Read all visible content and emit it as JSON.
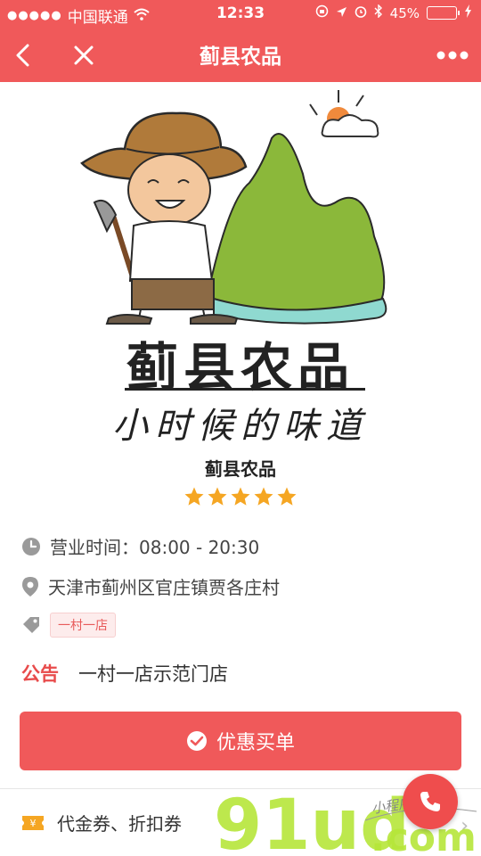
{
  "status_bar": {
    "carrier": "中国联通",
    "time": "12:33",
    "battery_percent": "45%",
    "battery_level": 0.45,
    "signal_dots": "●●●●●"
  },
  "nav": {
    "title": "蓟县农品",
    "back_icon": "chevron-left-icon",
    "close_icon": "close-icon",
    "more_icon": "more-dots-icon"
  },
  "logo": {
    "title": "蓟县农品",
    "slogan": "小时候的味道"
  },
  "shop": {
    "name": "蓟县农品",
    "rating": 5,
    "rating_max": 5,
    "hours_label": "营业时间：",
    "hours": "08:00 - 20:30",
    "address": "天津市蓟州区官庄镇贾各庄村",
    "tag": "一村一店"
  },
  "notice": {
    "label": "公告",
    "text": "一村一店示范门店"
  },
  "pay_button": {
    "label": "优惠买单"
  },
  "coupon": {
    "label": "代金券、折扣券"
  },
  "watermark": {
    "brand": "91ud",
    "domain": ".com",
    "note": "小程序商店"
  },
  "colors": {
    "brand_red": "#f0595a",
    "star": "#f5a623",
    "mountain": "#8bb83a"
  }
}
